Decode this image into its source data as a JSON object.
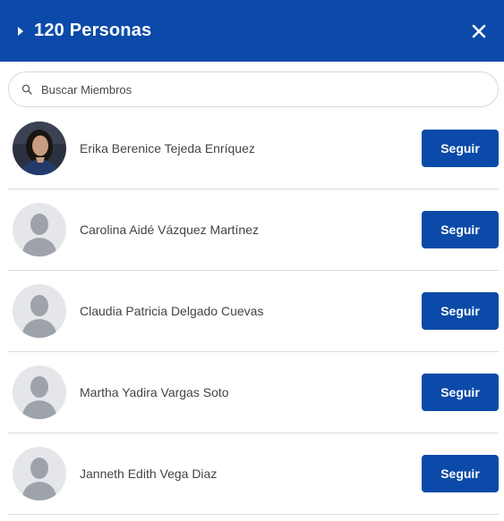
{
  "header": {
    "title": "120 Personas",
    "background_color": "#0b4aa8",
    "close_icon": "close-icon",
    "expand_icon": "caret-right-icon"
  },
  "search": {
    "placeholder": "Buscar Miembros",
    "value": "",
    "icon": "search-icon"
  },
  "members": [
    {
      "name": "Erika Berenice Tejeda Enríquez",
      "avatar": "photo",
      "button_label": "Seguir"
    },
    {
      "name": "Carolina Aidé Vázquez Martínez",
      "avatar": "default",
      "button_label": "Seguir"
    },
    {
      "name": "Claudia Patricia Delgado Cuevas",
      "avatar": "default",
      "button_label": "Seguir"
    },
    {
      "name": "Martha Yadira Vargas Soto",
      "avatar": "default",
      "button_label": "Seguir"
    },
    {
      "name": "Janneth Edith Vega Diaz",
      "avatar": "default",
      "button_label": "Seguir"
    }
  ],
  "colors": {
    "accent": "#0b4aa8",
    "divider": "#dcdcdc",
    "avatar_bg": "#e4e6ea",
    "avatar_fg": "#9ea3ab"
  }
}
